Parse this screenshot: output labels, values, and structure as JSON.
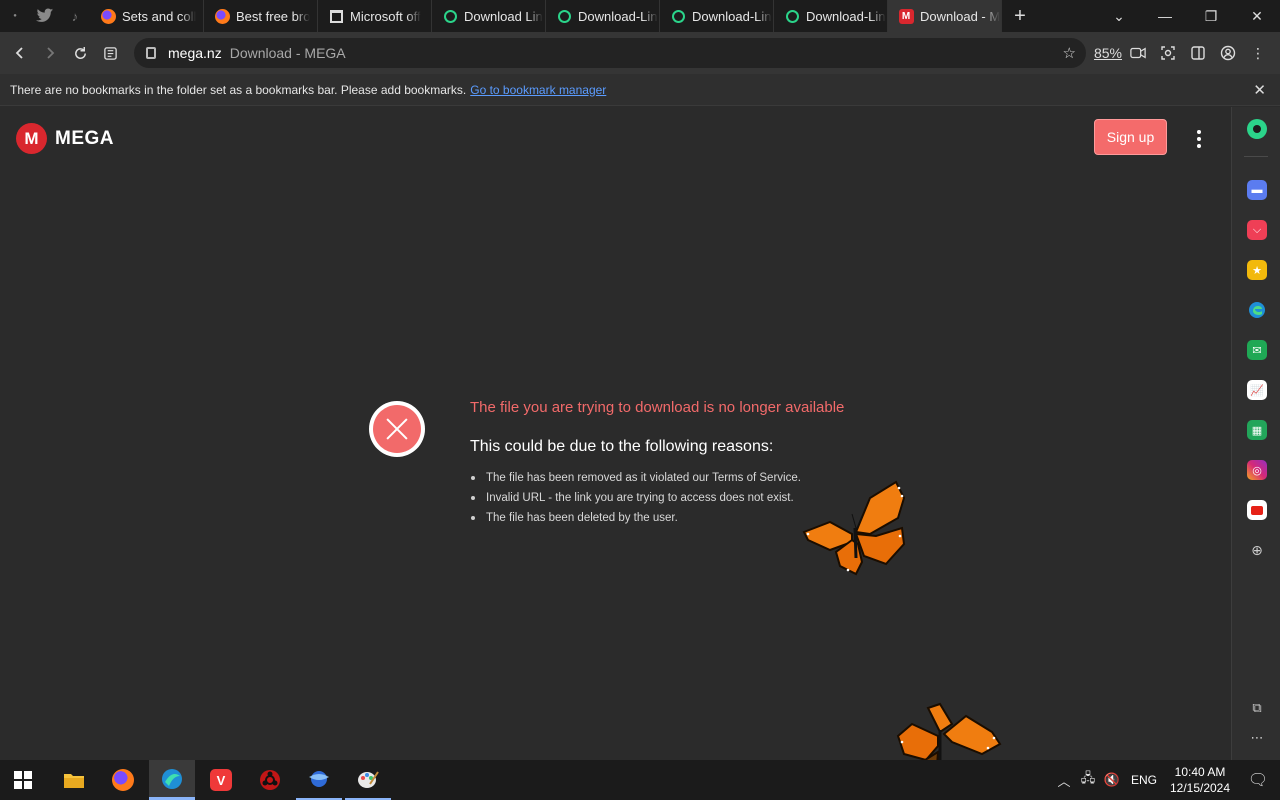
{
  "tabs": [
    {
      "label": "Sets and coll",
      "icon": "firefox-icon",
      "active": false
    },
    {
      "label": "Best free bro",
      "icon": "firefox-icon",
      "active": false
    },
    {
      "label": "Microsoft off",
      "icon": "microsoft-icon",
      "active": false
    },
    {
      "label": "Download Lin",
      "icon": "green-ring-icon",
      "active": false
    },
    {
      "label": "Download-Lin",
      "icon": "green-ring-icon",
      "active": false
    },
    {
      "label": "Download-Lin",
      "icon": "green-ring-icon",
      "active": false
    },
    {
      "label": "Download-Lin",
      "icon": "green-ring-icon",
      "active": false
    },
    {
      "label": "Download - M",
      "icon": "mega-icon",
      "active": true
    }
  ],
  "toolbar": {
    "domain": "mega.nz",
    "page_title": "Download - MEGA",
    "zoom": "85%"
  },
  "bookmarks_bar": {
    "message": "There are no bookmarks in the folder set as a bookmarks bar. Please add bookmarks.",
    "link": "Go to bookmark manager"
  },
  "mega": {
    "brand": "MEGA",
    "signup_label": "Sign up",
    "error_title": "The file you are trying to download is no longer available",
    "error_subtitle": "This could be due to the following reasons:",
    "reasons": [
      "The file has been removed as it violated our Terms of Service.",
      "Invalid URL - the link you are trying to access does not exist.",
      "The file has been deleted by the user."
    ]
  },
  "colors": {
    "accent_red": "#f26a6a",
    "mega_red": "#d9272e",
    "signup_bg": "#f46b6b",
    "link_blue": "#5b9cff"
  },
  "taskbar": {
    "language": "ENG",
    "time": "10:40 AM",
    "date": "12/15/2024"
  }
}
